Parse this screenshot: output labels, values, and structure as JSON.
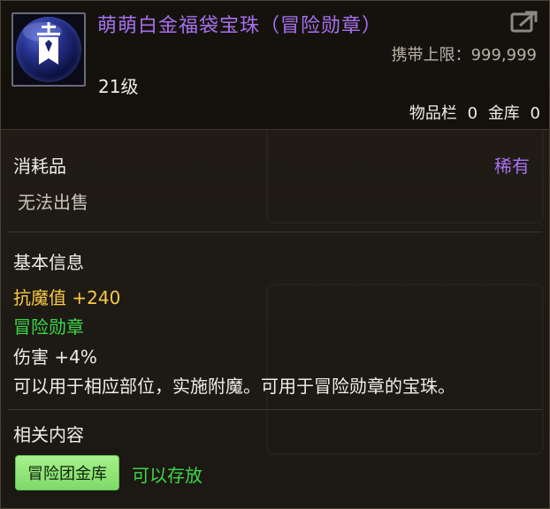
{
  "item": {
    "name": "萌萌白金福袋宝珠（冒险勋章）",
    "icon": "banner-orb-icon",
    "carry_limit_label": "携带上限：",
    "carry_limit_value": "999,999",
    "level": "21级"
  },
  "storage": {
    "inventory_label": "物品栏",
    "inventory_count": "0",
    "bank_label": "金库",
    "bank_count": "0"
  },
  "category": {
    "type": "消耗品",
    "rarity": "稀有",
    "sell_status": "无法出售"
  },
  "basic_info": {
    "title": "基本信息",
    "magic_resist": "抗魔值 +240",
    "slot": "冒险勋章",
    "damage": "伤害 +4%",
    "description": "可以用于相应部位，实施附魔。可用于冒险勋章的宝珠。"
  },
  "related": {
    "title": "相关内容",
    "tag": "冒险团金库",
    "tag_status": "可以存放"
  },
  "colors": {
    "rarity": "#a870f0",
    "gold_stat": "#f6c94a",
    "green": "#3cd64a",
    "tag_bg": "#a6f28a"
  }
}
